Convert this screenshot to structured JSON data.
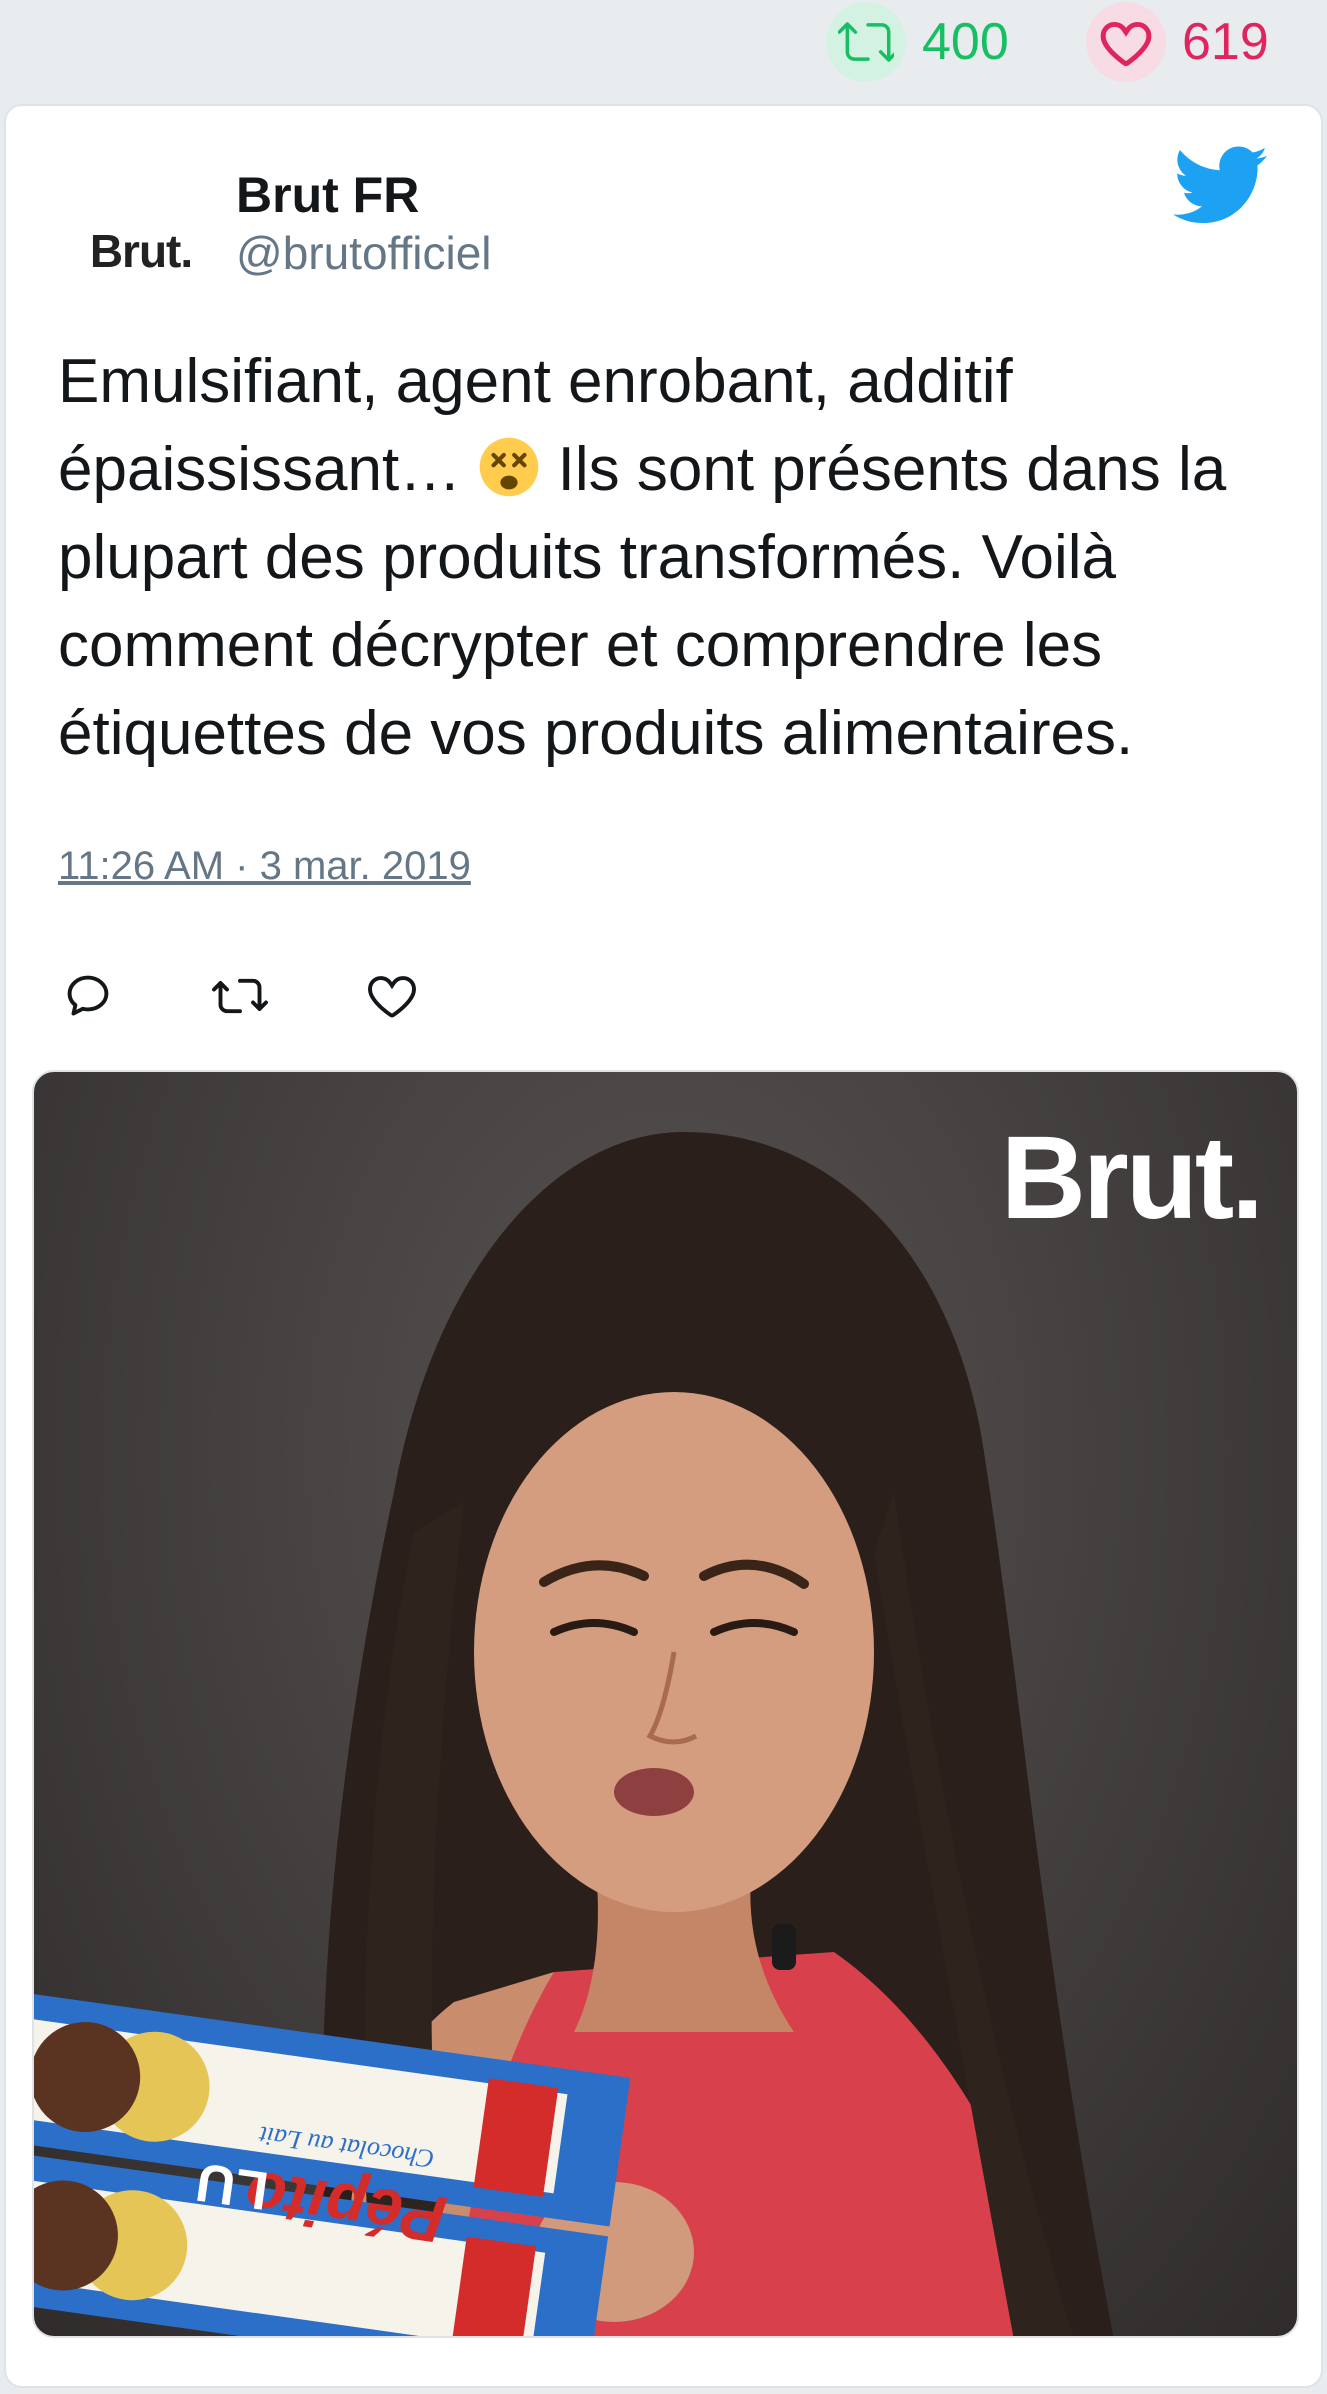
{
  "engagement": {
    "retweets": "400",
    "likes": "619"
  },
  "tweet": {
    "author_name": "Brut FR",
    "author_handle": "@brutofficiel",
    "avatar_text": "Brut.",
    "text_before_emoji": "Emulsifiant, agent enrobant, additif épaississant… ",
    "text_after_emoji": " Ils sont présents dans la plupart des produits transformés. Voilà comment décrypter et comprendre les étiquettes de vos produits alimentaires.",
    "timestamp": "11:26 AM · 3 mar. 2019"
  },
  "media": {
    "watermark": "Brut.",
    "box_brand": "LU",
    "box_product": "Pépito",
    "box_flavor": "Chocolat au Lait"
  },
  "icons": {
    "retweet": "retweet-icon",
    "like": "heart-icon",
    "brand": "twitter-bird-icon",
    "reply": "reply-icon",
    "emoji": "dizzy-face-emoji"
  },
  "colors": {
    "retweet": "#17bf63",
    "like": "#e0245e",
    "twitter_blue": "#1da1f2",
    "secondary_text": "#657786"
  }
}
